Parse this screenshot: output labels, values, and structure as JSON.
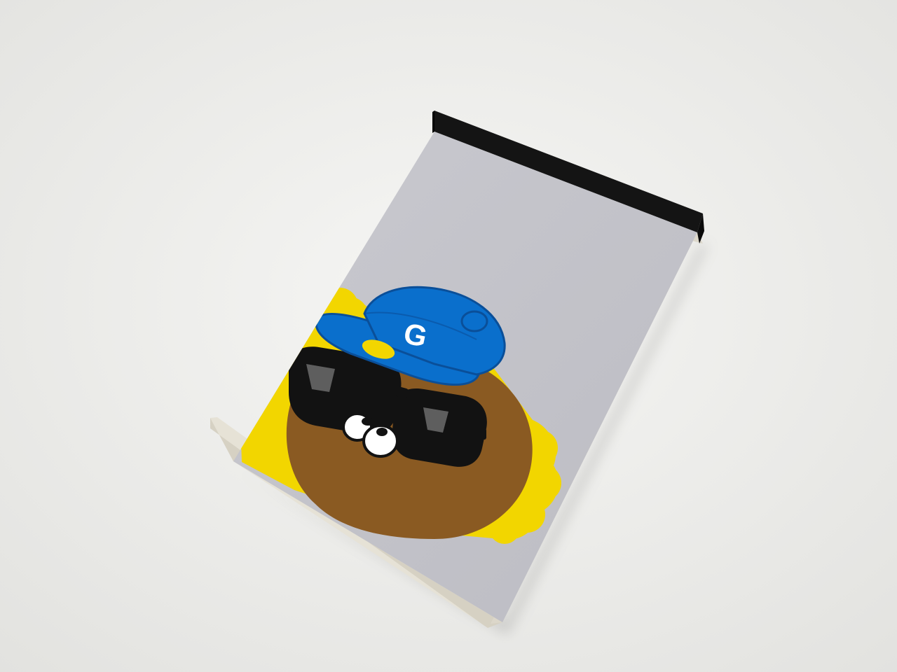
{
  "photo": {
    "subject": "notepad",
    "colors": {
      "background": "#eeeeec",
      "cover": "#c4c4ca",
      "binding": "#141414",
      "page_edge": "#e6e2d6",
      "mane": "#f2d600",
      "face": "#8a5a22",
      "cap": "#0a6fcc",
      "cap_button": "#f2d600",
      "glasses": "#121212",
      "lens_highlight": "#5e5e5e",
      "nose": "#ffffff"
    },
    "cap_logo": "G"
  }
}
